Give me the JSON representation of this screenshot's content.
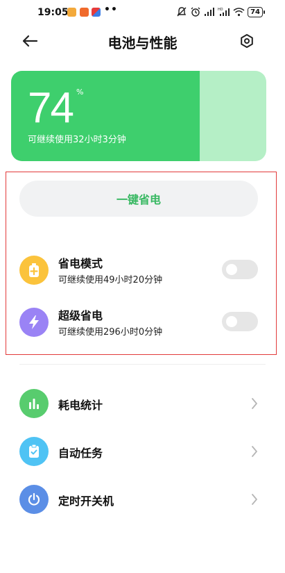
{
  "status_bar": {
    "time": "19:05",
    "dots": "••",
    "battery_level": "74",
    "right_icons": [
      "silent-icon",
      "alarm-icon",
      "cell-signal-icon",
      "hd-signal-icon",
      "wifi-icon",
      "battery-icon"
    ]
  },
  "header": {
    "title": "电池与性能",
    "back_icon": "arrow-left-icon",
    "settings_icon": "settings-icon"
  },
  "battery": {
    "level": "74",
    "level_fraction": 0.74,
    "unit": "%",
    "remaining": "可继续使用32小时3分钟",
    "colors": {
      "fill": "#3ecf6d",
      "track": "#b5efc6"
    }
  },
  "one_key": {
    "label": "一键省电",
    "color": "#38b862"
  },
  "modes": [
    {
      "title": "省电模式",
      "subtitle": "可继续使用49小时20分钟",
      "icon": "battery-plus-icon",
      "color": "#fbc33c",
      "enabled": false
    },
    {
      "title": "超级省电",
      "subtitle": "可继续使用296小时0分钟",
      "icon": "lightning-icon",
      "color": "#9a83f5",
      "enabled": false
    }
  ],
  "list": [
    {
      "label": "耗电统计",
      "icon": "bar-chart-icon",
      "color": "#58cc6e"
    },
    {
      "label": "自动任务",
      "icon": "clipboard-check-icon",
      "color": "#4fc3f4"
    },
    {
      "label": "定时开关机",
      "icon": "power-icon",
      "color": "#5b8ee6"
    }
  ]
}
